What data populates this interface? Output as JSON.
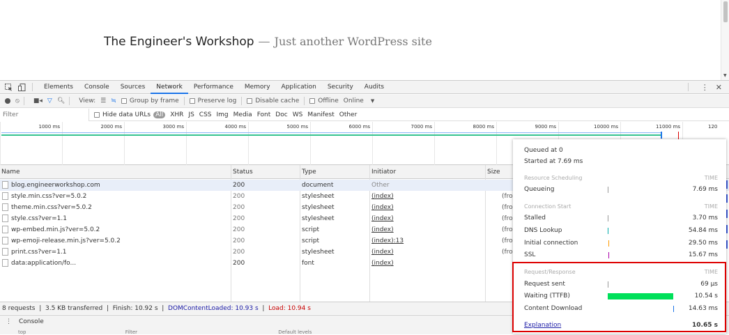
{
  "page": {
    "site_title": "The Engineer's Workshop",
    "separator": "—",
    "tagline": "Just another WordPress site"
  },
  "devtools": {
    "tabs": [
      "Elements",
      "Console",
      "Sources",
      "Network",
      "Performance",
      "Memory",
      "Application",
      "Security",
      "Audits"
    ],
    "active_tab": "Network",
    "toolbar": {
      "view_label": "View:",
      "group_by_frame": "Group by frame",
      "preserve_log": "Preserve log",
      "disable_cache": "Disable cache",
      "offline": "Offline",
      "throttle": "Online"
    },
    "filter": {
      "placeholder": "Filter",
      "hide_data_urls": "Hide data URLs",
      "types": [
        "All",
        "XHR",
        "JS",
        "CSS",
        "Img",
        "Media",
        "Font",
        "Doc",
        "WS",
        "Manifest",
        "Other"
      ]
    },
    "timeline_ticks": [
      "1000 ms",
      "2000 ms",
      "3000 ms",
      "4000 ms",
      "5000 ms",
      "6000 ms",
      "7000 ms",
      "8000 ms",
      "9000 ms",
      "10000 ms",
      "11000 ms",
      "120"
    ],
    "columns": [
      "Name",
      "Status",
      "Type",
      "Initiator",
      "Size"
    ],
    "requests": [
      {
        "name": "blog.engineerworkshop.com",
        "status": "200",
        "type": "document",
        "initiator": "Other",
        "size": ""
      },
      {
        "name": "style.min.css?ver=5.0.2",
        "status": "200",
        "type": "stylesheet",
        "initiator": "(index)",
        "size": "(from"
      },
      {
        "name": "theme.min.css?ver=5.0.2",
        "status": "200",
        "type": "stylesheet",
        "initiator": "(index)",
        "size": "(from"
      },
      {
        "name": "style.css?ver=1.1",
        "status": "200",
        "type": "stylesheet",
        "initiator": "(index)",
        "size": "(from"
      },
      {
        "name": "wp-embed.min.js?ver=5.0.2",
        "status": "200",
        "type": "script",
        "initiator": "(index)",
        "size": "(from"
      },
      {
        "name": "wp-emoji-release.min.js?ver=5.0.2",
        "status": "200",
        "type": "script",
        "initiator": "(index):13",
        "size": "(from"
      },
      {
        "name": "print.css?ver=1.1",
        "status": "200",
        "type": "stylesheet",
        "initiator": "(index)",
        "size": "(from"
      },
      {
        "name": "data:application/fo...",
        "status": "200",
        "type": "font",
        "initiator": "(index)",
        "size": ""
      }
    ],
    "summary": {
      "requests": "8 requests",
      "transferred": "3.5 KB transferred",
      "finish": "Finish: 10.92 s",
      "dcl": "DOMContentLoaded: 10.93 s",
      "load": "Load: 10.94 s"
    },
    "drawer": {
      "title": "Console",
      "sub_left": "top",
      "sub_filter": "Filter",
      "sub_levels": "Default levels"
    }
  },
  "timing_popup": {
    "queued": "Queued at 0",
    "started": "Started at 7.69 ms",
    "time_label": "TIME",
    "sections": [
      {
        "title": "Resource Scheduling",
        "rows": [
          {
            "label": "Queueing",
            "value": "7.69 ms"
          }
        ]
      },
      {
        "title": "Connection Start",
        "rows": [
          {
            "label": "Stalled",
            "value": "3.70 ms"
          },
          {
            "label": "DNS Lookup",
            "value": "54.84 ms"
          },
          {
            "label": "Initial connection",
            "value": "29.50 ms"
          },
          {
            "label": "SSL",
            "value": "15.67 ms"
          }
        ]
      },
      {
        "title": "Request/Response",
        "rows": [
          {
            "label": "Request sent",
            "value": "69 µs"
          },
          {
            "label": "Waiting (TTFB)",
            "value": "10.54 s"
          },
          {
            "label": "Content Download",
            "value": "14.63 ms"
          }
        ]
      }
    ],
    "explanation": "Explanation",
    "total": "10.65 s",
    "colors": {
      "ttfb": "#00e05a",
      "highlight": "#dd0000"
    }
  }
}
